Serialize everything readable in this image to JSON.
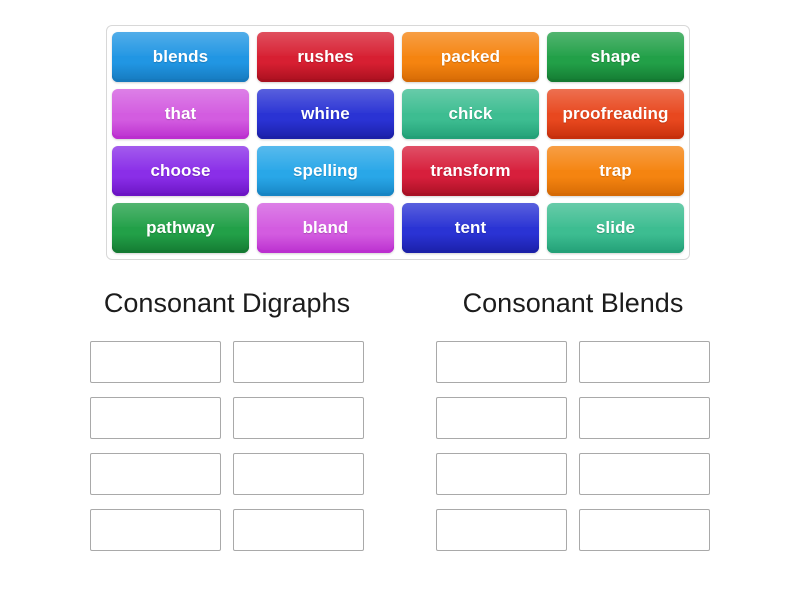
{
  "activity": {
    "type": "group-sort",
    "tile_pool": {
      "columns": 4,
      "rows": 4,
      "tiles": [
        {
          "label": "blends",
          "color": "#2196e3",
          "color_dark": "#1679bd"
        },
        {
          "label": "rushes",
          "color": "#d71f32",
          "color_dark": "#a8101f"
        },
        {
          "label": "packed",
          "color": "#f58410",
          "color_dark": "#d56a05"
        },
        {
          "label": "shape",
          "color": "#22a048",
          "color_dark": "#147a32"
        },
        {
          "label": "that",
          "color": "#d35ce0",
          "color_dark": "#bb2fcf"
        },
        {
          "label": "whine",
          "color": "#2a33d4",
          "color_dark": "#1b20a8"
        },
        {
          "label": "chick",
          "color": "#3dbd91",
          "color_dark": "#23a077"
        },
        {
          "label": "proofreading",
          "color": "#e8481f",
          "color_dark": "#c62f0c"
        },
        {
          "label": "choose",
          "color": "#8a2ee8",
          "color_dark": "#6b14c4"
        },
        {
          "label": "spelling",
          "color": "#29a7e8",
          "color_dark": "#1785c4"
        },
        {
          "label": "transform",
          "color": "#d71f3c",
          "color_dark": "#a81024"
        },
        {
          "label": "trap",
          "color": "#f58410",
          "color_dark": "#d56a05"
        },
        {
          "label": "pathway",
          "color": "#22a048",
          "color_dark": "#147a32"
        },
        {
          "label": "bland",
          "color": "#d35ce0",
          "color_dark": "#bb2fcf"
        },
        {
          "label": "tent",
          "color": "#2a33d4",
          "color_dark": "#1b20a8"
        },
        {
          "label": "slide",
          "color": "#3dbd91",
          "color_dark": "#23a077"
        }
      ]
    },
    "categories": [
      {
        "title": "Consonant Digraphs",
        "slots": [
          "",
          "",
          "",
          "",
          "",
          "",
          "",
          ""
        ]
      },
      {
        "title": "Consonant Blends",
        "slots": [
          "",
          "",
          "",
          "",
          "",
          "",
          "",
          ""
        ]
      }
    ],
    "colors": {
      "pool_border": "#d8d8d8",
      "slot_border": "#a9a9a9",
      "title_text": "#1c1c1c",
      "tile_text": "#ffffff",
      "background": "#ffffff"
    }
  }
}
